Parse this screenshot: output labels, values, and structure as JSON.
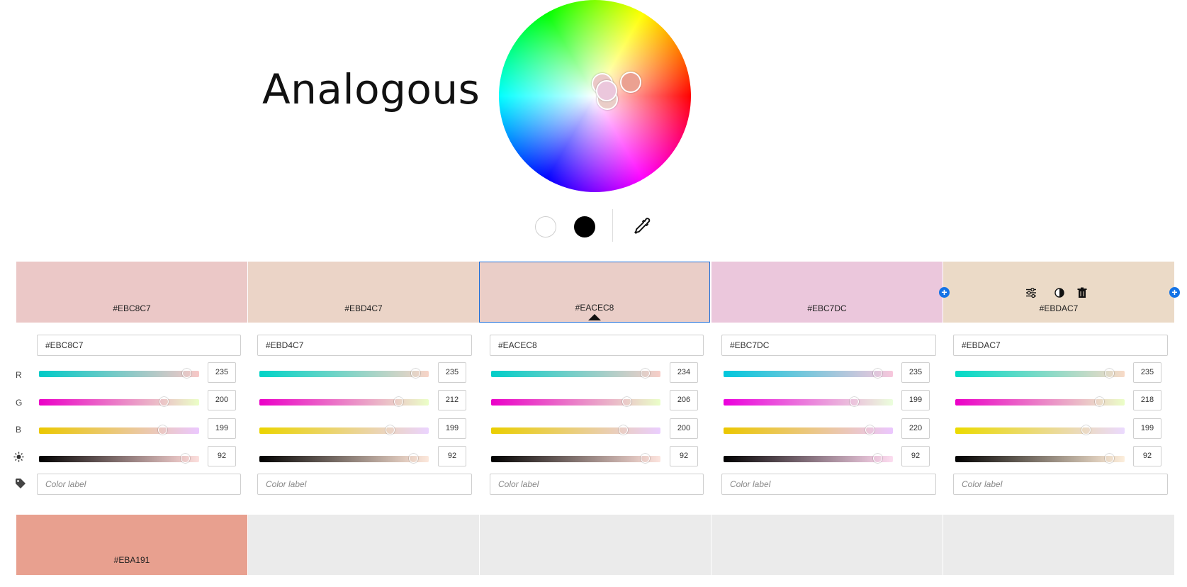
{
  "title": "Analogous",
  "wheel": {
    "handles": [
      {
        "color": "#EBC8C7",
        "size": 30
      },
      {
        "color": "#EBA191",
        "size": 30
      },
      {
        "color": "#EACEC8",
        "size": 30
      },
      {
        "color": "#EBC7DC",
        "size": 30
      }
    ]
  },
  "mode_buttons": [
    {
      "name": "white-mode-button",
      "color": "#ffffff"
    },
    {
      "name": "black-mode-button",
      "color": "#000000"
    }
  ],
  "channels": [
    "R",
    "G",
    "B",
    "brightness-icon"
  ],
  "columns": [
    {
      "hex": "#EBC8C7",
      "r": "235",
      "g": "200",
      "b": "199",
      "br": "92",
      "rf": 0.92,
      "gf": 0.78,
      "bf": 0.77,
      "brf": 0.91,
      "placeholder": "Color label"
    },
    {
      "hex": "#EBD4C7",
      "r": "235",
      "g": "212",
      "b": "199",
      "br": "92",
      "rf": 0.92,
      "gf": 0.82,
      "bf": 0.77,
      "brf": 0.91,
      "placeholder": "Color label"
    },
    {
      "hex": "#EACEC8",
      "r": "234",
      "g": "206",
      "b": "200",
      "br": "92",
      "rf": 0.91,
      "gf": 0.8,
      "bf": 0.78,
      "brf": 0.91,
      "placeholder": "Color label",
      "selected": true
    },
    {
      "hex": "#EBC7DC",
      "r": "235",
      "g": "199",
      "b": "220",
      "br": "92",
      "rf": 0.91,
      "gf": 0.77,
      "bf": 0.86,
      "brf": 0.91,
      "placeholder": "Color label"
    },
    {
      "hex": "#EBDAC7",
      "r": "235",
      "g": "218",
      "b": "199",
      "br": "92",
      "rf": 0.91,
      "gf": 0.85,
      "bf": 0.77,
      "brf": 0.91,
      "placeholder": "Color label"
    }
  ],
  "bottom_row": [
    {
      "hex": "#EBA191",
      "color": "#E8A08F"
    },
    {
      "hex": "",
      "color": "#EBEBEB"
    },
    {
      "hex": "",
      "color": "#EBEBEB"
    },
    {
      "hex": "",
      "color": "#EBEBEB"
    },
    {
      "hex": "",
      "color": "#EBEBEB"
    }
  ],
  "icons": {
    "add": "+",
    "adjust": "sliders-icon",
    "contrast": "contrast-icon",
    "delete": "trash-icon",
    "eyedropper": "eyedropper-icon",
    "tag": "tag-icon"
  }
}
